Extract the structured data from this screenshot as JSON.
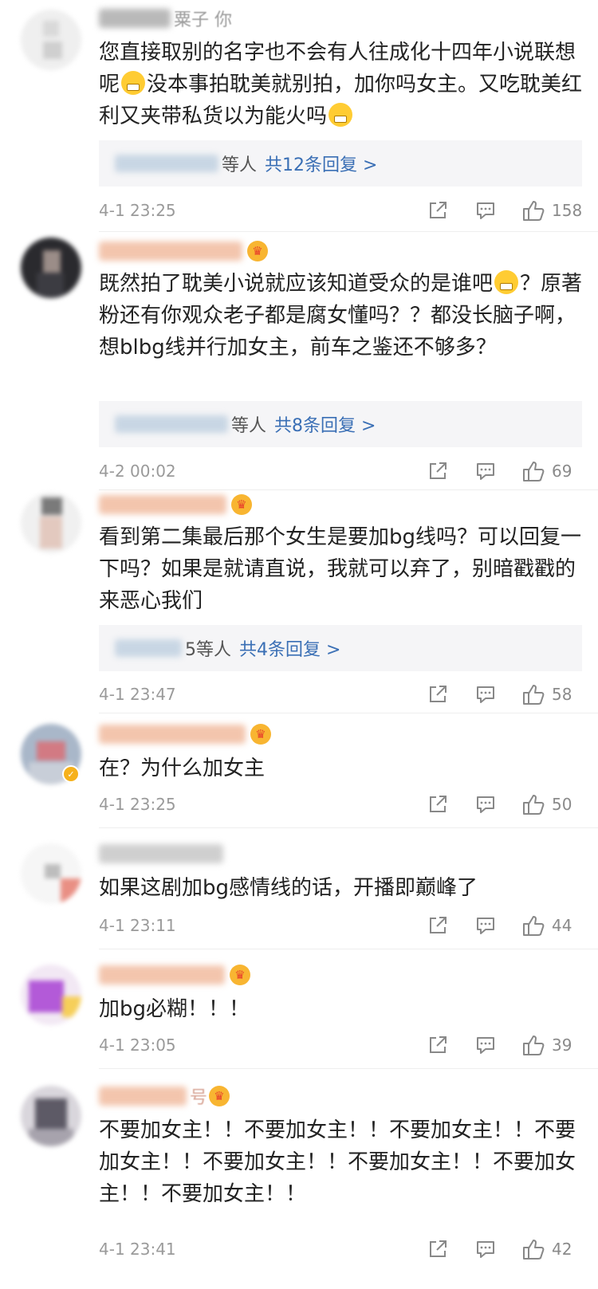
{
  "comments": [
    {
      "username_visible": "粟子 你",
      "text": "您直接取别的名字也不会有人往成化十四年小说联想呢",
      "text_b": "没本事拍耽美就别拍，加你吗女主。又吃耽美红利又夹带私货以为能火吗",
      "replies_who": "等人",
      "replies_count": "共12条回复 >",
      "time": "4-1 23:25",
      "likes": "158"
    },
    {
      "text": "既然拍了耽美小说就应该知道受众的是谁吧",
      "text_b": "？原著粉还有你观众老子都是腐女懂吗？？都没长脑子啊，想blbg线并行加女主，前车之鉴还不够多？",
      "replies_who": "等人",
      "replies_count": "共8条回复 >",
      "time": "4-2 00:02",
      "likes": "69"
    },
    {
      "text": "看到第二集最后那个女生是要加bg线吗？可以回复一下吗？如果是就请直说，我就可以弃了，别暗戳戳的来恶心我们",
      "replies_who": "5等人",
      "replies_count": "共4条回复 >",
      "time": "4-1 23:47",
      "likes": "58"
    },
    {
      "text": "在？为什么加女主",
      "time": "4-1 23:25",
      "likes": "50"
    },
    {
      "text": "如果这剧加bg感情线的话，开播即巅峰了",
      "time": "4-1 23:11",
      "likes": "44"
    },
    {
      "text": "加bg必糊！！！",
      "time": "4-1 23:05",
      "likes": "39"
    },
    {
      "username_visible": "号",
      "text": "不要加女主！！不要加女主！！不要加女主！！不要加女主！！不要加女主！！不要加女主！！不要加女主！！不要加女主！！",
      "time": "4-1 23:41",
      "likes": "42"
    }
  ],
  "icons": {
    "share": "share-icon",
    "comment": "comment-icon",
    "like": "thumbs-up-icon",
    "crown": "crown-badge-icon",
    "verified": "verified-badge-icon",
    "emoji_smile": "smile-emoji-icon",
    "emoji_grin": "grin-emoji-icon"
  },
  "colors": {
    "username": "#f08a5d",
    "reply_link": "#3a6fb5",
    "reply_bg": "#f5f5f7",
    "meta_text": "#9a9a9a",
    "body_text": "#222222"
  }
}
